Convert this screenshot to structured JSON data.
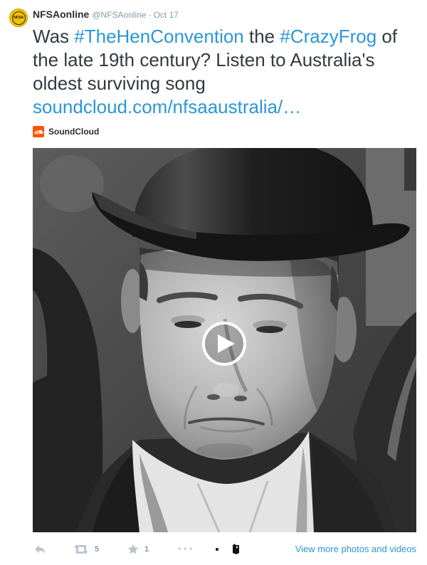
{
  "avatar": {
    "logo_text": "NFSA"
  },
  "tweet": {
    "display_name": "NFSAonline",
    "handle": "@NFSAonline",
    "separator": "·",
    "date": "Oct 17",
    "text": [
      {
        "kind": "text",
        "value": "Was "
      },
      {
        "kind": "hashtag",
        "value": "#TheHenConvention"
      },
      {
        "kind": "text",
        "value": " the "
      },
      {
        "kind": "hashtag",
        "value": "#CrazyFrog"
      },
      {
        "kind": "text",
        "value": " of the late 19th century? Listen to Australia's oldest surviving song "
      },
      {
        "kind": "link",
        "value": "soundcloud.com/nfsaaustralia/…"
      }
    ]
  },
  "card": {
    "provider_name": "SoundCloud",
    "provider_icon": "soundcloud-icon",
    "overlay_icon": "play-icon"
  },
  "actions": {
    "reply_icon": "reply-icon",
    "retweet_icon": "retweet-icon",
    "retweet_count": "5",
    "favorite_icon": "star-icon",
    "favorite_count": "1",
    "more_label": "•••",
    "extension_icons": [
      "dot-icon",
      "extension-icon"
    ]
  },
  "view_more_label": "View more photos and videos",
  "colors": {
    "link": "#2b96d6",
    "text": "#333a40",
    "name": "#292f33",
    "muted": "#8899a6",
    "icon": "#b8c5cf",
    "avatar": "#f2c200",
    "brand": "#ff5500"
  }
}
